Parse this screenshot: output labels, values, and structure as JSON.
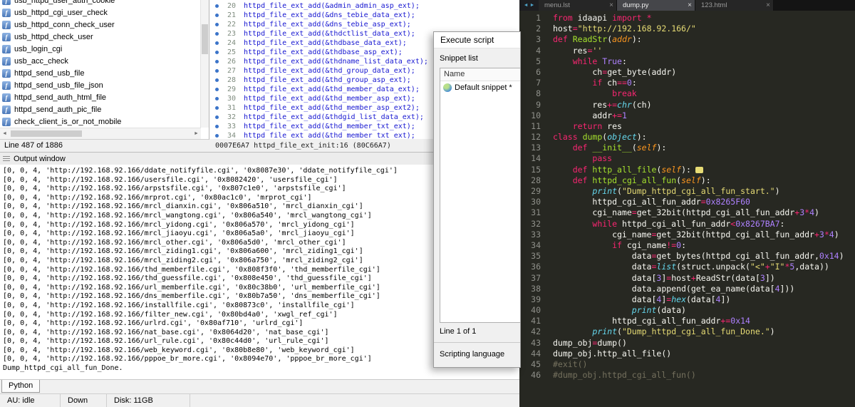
{
  "ida": {
    "colors": {
      "disasm_text": "#1616d1",
      "marker": "#3b74c9"
    },
    "functions_panel": {
      "items": [
        "usb_httpd_user_auth_cookie",
        "usb_httpd_cgi_user_check",
        "usb_httpd_conn_check_user",
        "usb_httpd_check_user",
        "usb_login_cgi",
        "usb_acc_check",
        "httpd_send_usb_file",
        "httpd_send_usb_file_json",
        "httpd_send_auth_html_file",
        "httpd_send_auth_pic_file",
        "check_client_is_or_not_mobile"
      ],
      "status": "Line 487 of 1886"
    },
    "pseudocode_panel": {
      "lines": [
        {
          "num": 20,
          "code": "httpd_file_ext_add(&admin_admin_asp_ext);"
        },
        {
          "num": 21,
          "code": "httpd_file_ext_add(&dns_tebie_data_ext);"
        },
        {
          "num": 22,
          "code": "httpd_file_ext_add(&dns_tebie_asp_ext);"
        },
        {
          "num": 23,
          "code": "httpd_file_ext_add(&thdctlist_data_ext);"
        },
        {
          "num": 24,
          "code": "httpd_file_ext_add(&thdbase_data_ext);"
        },
        {
          "num": 25,
          "code": "httpd_file_ext_add(&thdbase_asp_ext);"
        },
        {
          "num": 26,
          "code": "httpd_file_ext_add(&thdname_list_data_ext);"
        },
        {
          "num": 27,
          "code": "httpd_file_ext_add(&thd_group_data_ext);"
        },
        {
          "num": 28,
          "code": "httpd_file_ext_add(&thd_group_asp_ext);"
        },
        {
          "num": 29,
          "code": "httpd_file_ext_add(&thd_member_data_ext);"
        },
        {
          "num": 30,
          "code": "httpd_file_ext_add(&thd_member_asp_ext);"
        },
        {
          "num": 31,
          "code": "httpd_file_ext_add(&thd_member_asp_ext2);"
        },
        {
          "num": 32,
          "code": "httpd_file_ext_add(&thdgid_list_data_ext);"
        },
        {
          "num": 33,
          "code": "httpd_file_ext_add(&thd_member_txt_ext);"
        },
        {
          "num": 34,
          "code": "httpd_file_ext_add(&thd_member_txt_ext);"
        }
      ],
      "status": "0007E6A7 httpd_file_ext_init:16 (80C66A7)"
    },
    "execute_script_dialog": {
      "title": "Execute script",
      "group_label": "Snippet list",
      "column_header": "Name",
      "snippet_name": "Default snippet *",
      "line_status": "Line 1 of 1",
      "language_label": "Scripting language"
    },
    "output_window": {
      "title": "Output window",
      "tab": "Python",
      "lines": [
        "[0, 0, 4, 'http://192.168.92.166/ddate_notifyfile.cgi', '0x8087e30', 'ddate_notifyfile_cgi']",
        "[0, 0, 4, 'http://192.168.92.166/usersfile.cgi', '0x8082420', 'usersfile_cgi']",
        "[0, 0, 4, 'http://192.168.92.166/arpstsfile.cgi', '0x807c1e0', 'arpstsfile_cgi']",
        "[0, 0, 4, 'http://192.168.92.166/mrprot.cgi', '0x80ac1c0', 'mrprot_cgi']",
        "[0, 0, 4, 'http://192.168.92.166/mrcl_dianxin.cgi', '0x806a510', 'mrcl_dianxin_cgi']",
        "[0, 0, 4, 'http://192.168.92.166/mrcl_wangtong.cgi', '0x806a540', 'mrcl_wangtong_cgi']",
        "[0, 0, 4, 'http://192.168.92.166/mrcl_yidong.cgi', '0x806a570', 'mrcl_yidong_cgi']",
        "[0, 0, 4, 'http://192.168.92.166/mrcl_jiaoyu.cgi', '0x806a5a0', 'mrcl_jiaoyu_cgi']",
        "[0, 0, 4, 'http://192.168.92.166/mrcl_other.cgi', '0x806a5d0', 'mrcl_other_cgi']",
        "[0, 0, 4, 'http://192.168.92.166/mrcl_ziding1.cgi', '0x806a600', 'mrcl_ziding1_cgi']",
        "[0, 0, 4, 'http://192.168.92.166/mrcl_ziding2.cgi', '0x806a750', 'mrcl_ziding2_cgi']",
        "[0, 0, 4, 'http://192.168.92.166/thd_memberfile.cgi', '0x808f3f0', 'thd_memberfile_cgi']",
        "[0, 0, 4, 'http://192.168.92.166/thd_guessfile.cgi', '0x808e450', 'thd_guessfile_cgi']",
        "[0, 0, 4, 'http://192.168.92.166/url_memberfile.cgi', '0x80c38b0', 'url_memberfile_cgi']",
        "[0, 0, 4, 'http://192.168.92.166/dns_memberfile.cgi', '0x80b7a50', 'dns_memberfile_cgi']",
        "[0, 0, 4, 'http://192.168.92.166/installfile.cgi', '0x80873c0', 'installfile_cgi']",
        "[0, 0, 4, 'http://192.168.92.166/filter_new.cgi', '0x80bd4a0', 'xwgl_ref_cgi']",
        "[0, 0, 4, 'http://192.168.92.166/urlrd.cgi', '0x80af710', 'urlrd_cgi']",
        "[0, 0, 4, 'http://192.168.92.166/nat_base.cgi', '0x8064d20', 'nat_base_cgi']",
        "[0, 0, 4, 'http://192.168.92.166/url_rule.cgi', '0x80c44d0', 'url_rule_cgi']",
        "[0, 0, 4, 'http://192.168.92.166/web_keyword.cgi', '0x80b8e80', 'web_keyword_cgi']",
        "[0, 0, 4, 'http://192.168.92.166/pppoe_br_more.cgi', '0x8094e70', 'pppoe_br_more_cgi']",
        "Dump_httpd_cgi_all_fun_Done."
      ]
    },
    "status_bar": {
      "au": "AU: idle",
      "state": "Down",
      "disk": "Disk: 11GB"
    }
  },
  "editor": {
    "theme": {
      "background": "#272822",
      "text": "#f8f8f2",
      "keyword": "#f92672",
      "string": "#e6db74",
      "number": "#ae81ff",
      "function_def": "#a6e22e",
      "builtin": "#66d9ef",
      "param": "#fd971f",
      "comment": "#75715e",
      "line_number": "#8f908a"
    },
    "tabs": [
      {
        "label": "menu.lst",
        "active": false
      },
      {
        "label": "dump.py",
        "active": true
      },
      {
        "label": "123.html",
        "active": false
      }
    ],
    "close_glyph": "×",
    "code_lines": [
      {
        "num": 1,
        "code": "from idaapi import *"
      },
      {
        "num": 2,
        "code": "host=\"http://192.168.92.166/\""
      },
      {
        "num": 3,
        "code": "def ReadStr(addr):"
      },
      {
        "num": 4,
        "code": "    res=''"
      },
      {
        "num": 5,
        "code": "    while True:"
      },
      {
        "num": 6,
        "code": "        ch=get_byte(addr)"
      },
      {
        "num": 7,
        "code": "        if ch==0:"
      },
      {
        "num": 8,
        "code": "            break"
      },
      {
        "num": 9,
        "code": "        res+=chr(ch)"
      },
      {
        "num": 10,
        "code": "        addr+=1"
      },
      {
        "num": 11,
        "code": "    return res"
      },
      {
        "num": 12,
        "code": "class dump(object):"
      },
      {
        "num": 13,
        "code": "    def __init__(self):"
      },
      {
        "num": 14,
        "code": "        pass"
      },
      {
        "num": 15,
        "code": "    def http_all_file(self):",
        "folded": true
      },
      {
        "num": 28,
        "code": "    def httpd_cgi_all_fun(self):"
      },
      {
        "num": 29,
        "code": "        print(\"Dump_httpd_cgi_all_fun_start.\")"
      },
      {
        "num": 30,
        "code": "        httpd_cgi_all_fun_addr=0x8265F60"
      },
      {
        "num": 31,
        "code": "        cgi_name=get_32bit(httpd_cgi_all_fun_addr+3*4)"
      },
      {
        "num": 32,
        "code": "        while httpd_cgi_all_fun_addr<0x8267BA7:"
      },
      {
        "num": 33,
        "code": "            cgi_name=get_32bit(httpd_cgi_all_fun_addr+3*4)"
      },
      {
        "num": 34,
        "code": "            if cgi_name!=0:"
      },
      {
        "num": 35,
        "code": "                data=get_bytes(httpd_cgi_all_fun_addr,0x14)"
      },
      {
        "num": 36,
        "code": "                data=list(struct.unpack(\"<\"+\"I\"*5,data))"
      },
      {
        "num": 37,
        "code": "                data[3]=host+ReadStr(data[3])"
      },
      {
        "num": 38,
        "code": "                data.append(get_ea_name(data[4]))"
      },
      {
        "num": 39,
        "code": "                data[4]=hex(data[4])"
      },
      {
        "num": 40,
        "code": "                print(data)"
      },
      {
        "num": 41,
        "code": "            httpd_cgi_all_fun_addr+=0x14"
      },
      {
        "num": 42,
        "code": "        print(\"Dump_httpd_cgi_all_fun_Done.\")"
      },
      {
        "num": 43,
        "code": "dump_obj=dump()"
      },
      {
        "num": 44,
        "code": "dump_obj.http_all_file()"
      },
      {
        "num": 45,
        "code": "#exit()"
      },
      {
        "num": 46,
        "code": "#dump_obj.httpd_cgi_all_fun()"
      }
    ]
  }
}
